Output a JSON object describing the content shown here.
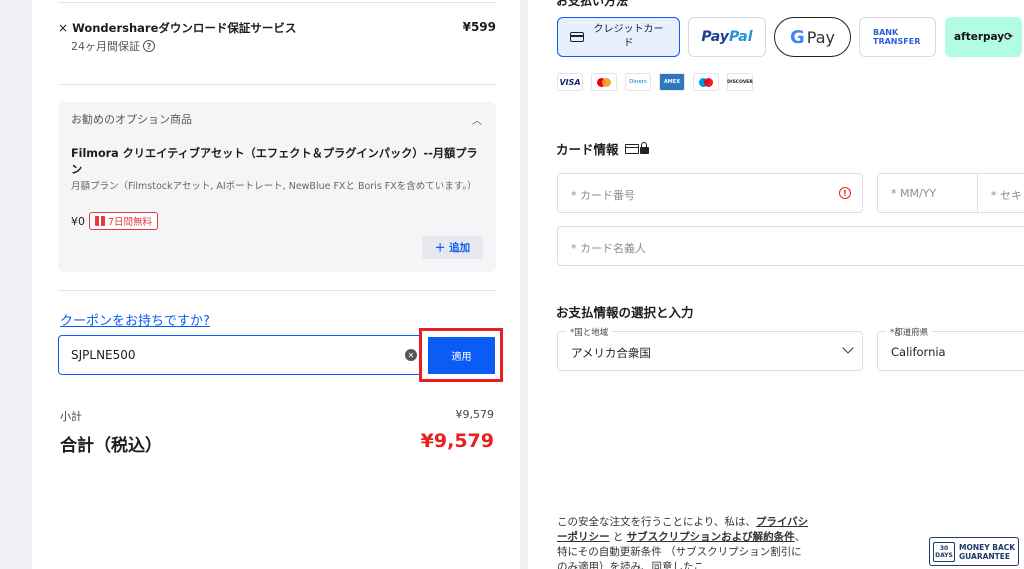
{
  "order": {
    "item": {
      "remove_symbol": "×",
      "name": "Wondershareダウンロード保証サービス",
      "price": "¥599",
      "sub": "24ヶ月間保証",
      "help_glyph": "?"
    },
    "option": {
      "header": "お勧めのオプション商品",
      "title": "Filmora クリエイティブアセット（エフェクト＆プラグインパック）--月額プラン",
      "description": "月額プラン（Filmstockアセット, AIポートレート, NewBlue FXと Boris FXを含めています。）",
      "price": "¥0",
      "badge": "7日間無料",
      "add_label": "＋ 追加"
    },
    "coupon": {
      "link": "クーポンをお持ちですか?",
      "value": "SJPLNE500",
      "apply_label": "適用"
    },
    "subtotal_label": "小計",
    "subtotal_value": "¥9,579",
    "total_label": "合計（税込）",
    "total_value": "¥9,579"
  },
  "payment": {
    "section_title": "お支払い方法",
    "methods": {
      "card": "クレジットカード",
      "paypal_1": "Pay",
      "paypal_2": "Pal",
      "gpay_g": "G",
      "gpay_text": "Pay",
      "bank_1": "BANK",
      "bank_2": "TRANSFER",
      "afterpay": "afterpay⟳"
    },
    "brands": {
      "visa": "VISA",
      "diners": "Diners",
      "amex": "AMEX",
      "discover": "DISCOVER"
    },
    "card_info_title": "カード情報",
    "fields": {
      "card_number": "* カード番号",
      "mmyy": "* MM/YY",
      "cvc": "* セキ",
      "holder": "* カード名義人"
    },
    "billing_title": "お支払情報の選択と入力",
    "country_label": "*国と地域",
    "country_value": "アメリカ合衆国",
    "state_label": "*都道府県",
    "state_value": "California",
    "legal_1": "この安全な注文を行うことにより、私は、",
    "legal_link_1": "プライバシーポリシー",
    "legal_2": " と ",
    "legal_link_2": "サブスクリプションおよび解約条件",
    "legal_3": "、特にその自動更新条件 （サブスクリプション割引にのみ適用）を読み、同意したこ",
    "guarantee_days": "30",
    "guarantee_days_label": "DAYS",
    "guarantee_1": "MONEY BACK",
    "guarantee_2": "GUARANTEE"
  }
}
